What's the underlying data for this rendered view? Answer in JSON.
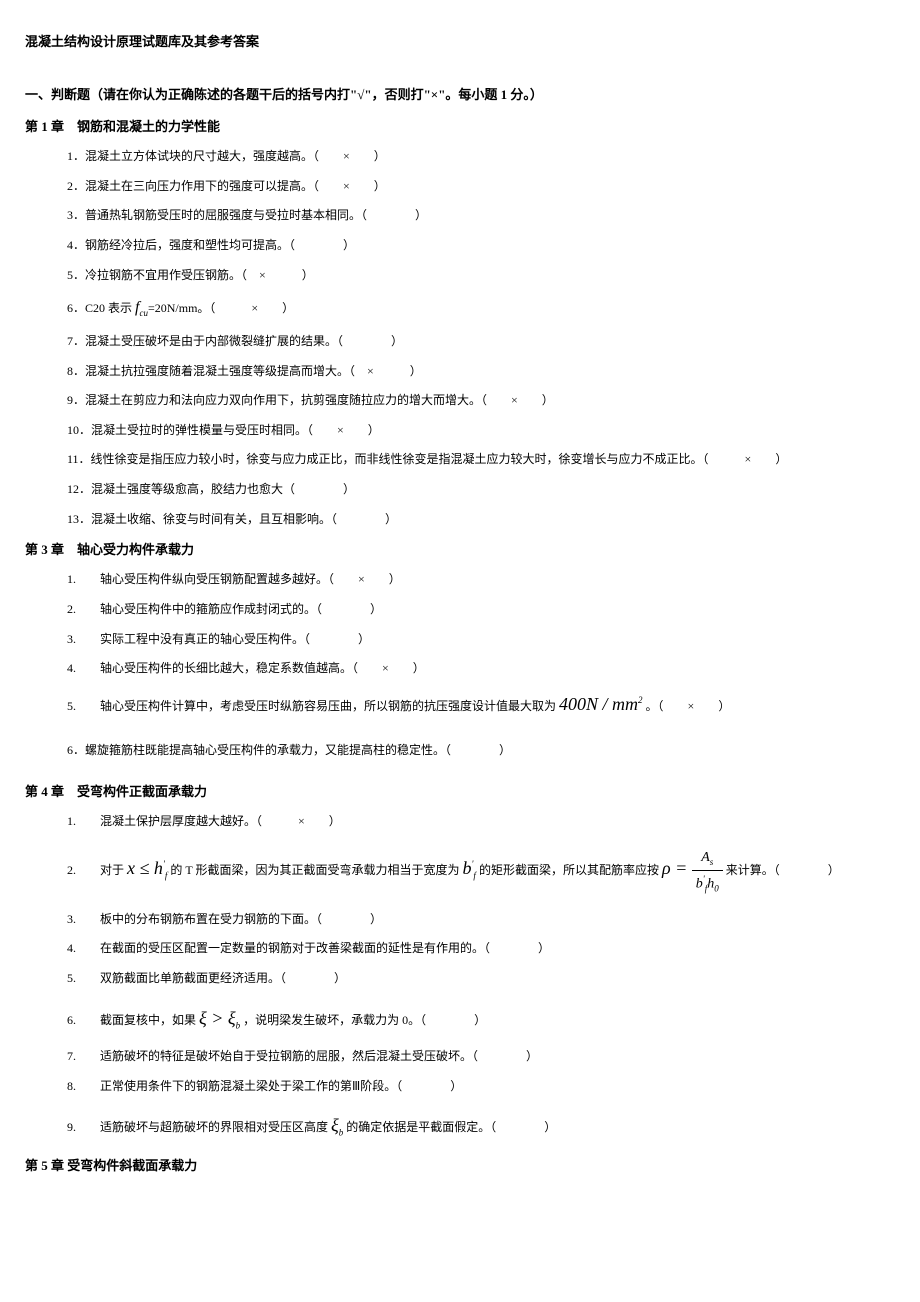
{
  "docTitle": "混凝土结构设计原理试题库及其参考答案",
  "sectionTitle": "一、判断题（请在你认为正确陈述的各题干后的括号内打\"√\"，否则打\"×\"。每小题 1 分。）",
  "ch1": {
    "title": "第 1 章　钢筋和混凝土的力学性能",
    "q1": "1．混凝土立方体试块的尺寸越大，强度越高。（　　×　　）",
    "q2": "2．混凝土在三向压力作用下的强度可以提高。（　　×　　）",
    "q3": "3．普通热轧钢筋受压时的屈服强度与受拉时基本相同。（　　　　）",
    "q4": "4．钢筋经冷拉后，强度和塑性均可提高。（　　　　）",
    "q5": "5．冷拉钢筋不宜用作受压钢筋。（　×　　　）",
    "q6_pre": "6．C20 表示 ",
    "q6_f": "f",
    "q6_sub": "cu",
    "q6_post": "=20N/mm。（　　　×　　）",
    "q7": "7．混凝土受压破坏是由于内部微裂缝扩展的结果。（　　　　）",
    "q8": "8．混凝土抗拉强度随着混凝土强度等级提高而增大。（　×　　　）",
    "q9": "9．混凝土在剪应力和法向应力双向作用下，抗剪强度随拉应力的增大而增大。（　　×　　）",
    "q10": "10．混凝土受拉时的弹性模量与受压时相同。（　　×　　）",
    "q11": "11．线性徐变是指压应力较小时，徐变与应力成正比，而非线性徐变是指混凝土应力较大时，徐变增长与应力不成正比。（　　　×　　）",
    "q12": "12．混凝土强度等级愈高，胶结力也愈大（　　　　）",
    "q13": "13．混凝土收缩、徐变与时间有关，且互相影响。（　　　　）"
  },
  "ch3": {
    "title": "第 3 章　轴心受力构件承载力",
    "q1": "1.　　轴心受压构件纵向受压钢筋配置越多越好。（　　×　　）",
    "q2": "2.　　轴心受压构件中的箍筋应作成封闭式的。（　　　　）",
    "q3": "3.　　实际工程中没有真正的轴心受压构件。（　　　　）",
    "q4": "4.　　轴心受压构件的长细比越大，稳定系数值越高。（　　×　　）",
    "q5_pre": "5.　　轴心受压构件计算中，考虑受压时纵筋容易压曲，所以钢筋的抗压强度设计值最大取为 ",
    "q5_post": " 。（　　×　　）",
    "q6": "6．螺旋箍筋柱既能提高轴心受压构件的承载力，又能提高柱的稳定性。（　　　　）"
  },
  "ch4": {
    "title": "第 4 章　受弯构件正截面承载力",
    "q1": "1.　　混凝土保护层厚度越大越好。（　　　×　　）",
    "q2_pre": "2.　　对于 ",
    "q2_mid1": " 的 T 形截面梁，因为其正截面受弯承载力相当于宽度为 ",
    "q2_mid2": " 的矩形截面梁，所以其配筋率应按 ",
    "q2_post": " 来计算。（　　　　）",
    "q3": "3.　　板中的分布钢筋布置在受力钢筋的下面。（　　　　）",
    "q4": "4.　　在截面的受压区配置一定数量的钢筋对于改善梁截面的延性是有作用的。（　　　　）",
    "q5": "5.　　双筋截面比单筋截面更经济适用。（　　　　）",
    "q6_pre": "6.　　截面复核中，如果 ",
    "q6_post": " ，说明梁发生破坏，承载力为 0。（　　　　）",
    "q7": "7.　　适筋破坏的特征是破坏始自于受拉钢筋的屈服，然后混凝土受压破坏。（　　　　）",
    "q8": "8.　　正常使用条件下的钢筋混凝土梁处于梁工作的第Ⅲ阶段。（　　　　）",
    "q9_pre": "9.　　适筋破坏与超筋破坏的界限相对受压区高度 ",
    "q9_post": " 的确定依据是平截面假定。（　　　　）"
  },
  "ch5": {
    "title": "第 5 章 受弯构件斜截面承载力"
  }
}
